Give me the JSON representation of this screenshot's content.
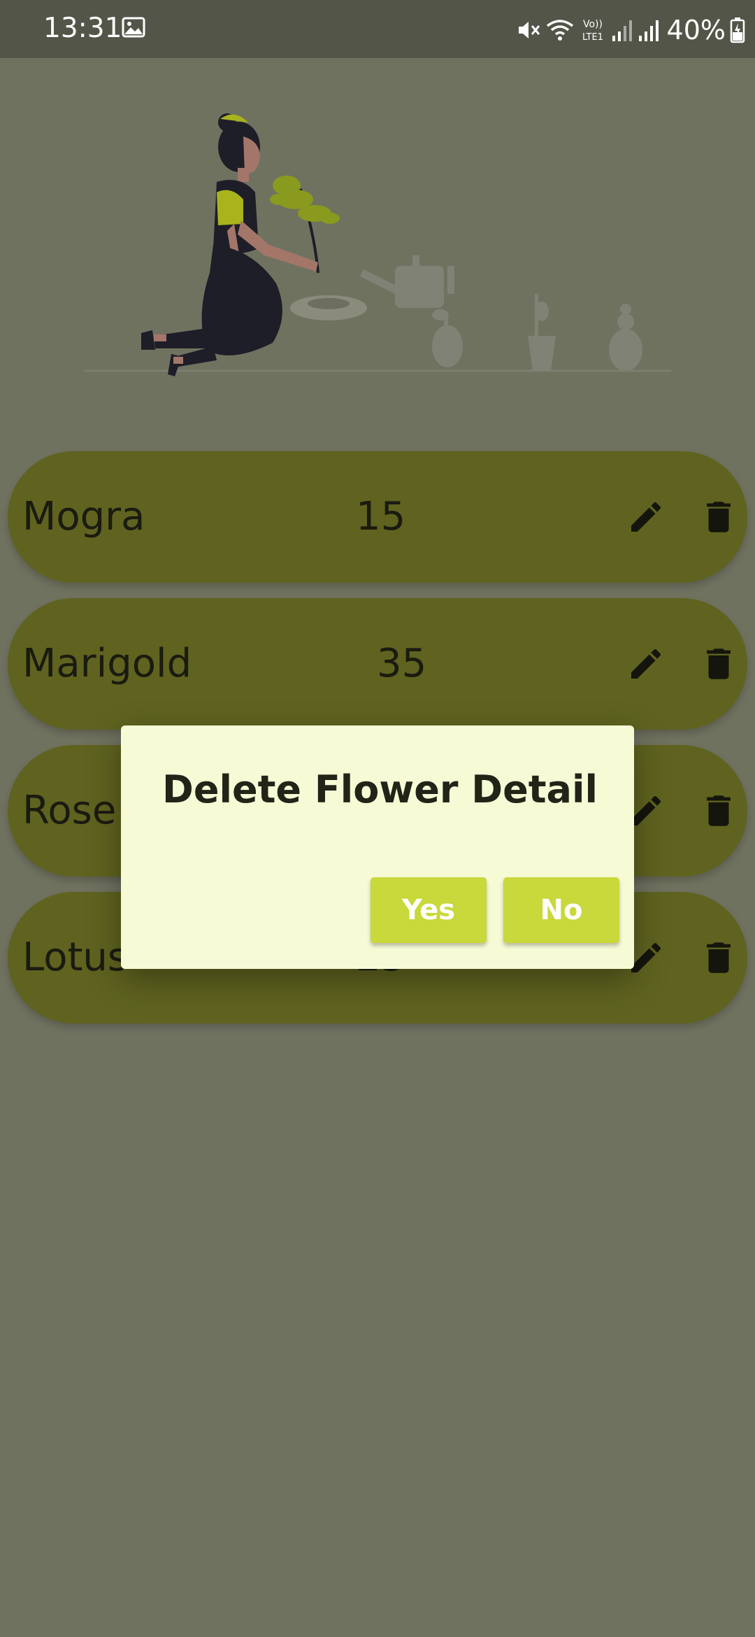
{
  "status_bar": {
    "time": "13:31",
    "battery": "40%",
    "icons": [
      "gallery-icon",
      "mute-icon",
      "wifi-icon",
      "volte-icon",
      "signal-icon",
      "signal-icon",
      "battery-charging-icon"
    ],
    "volte_label_top": "Vo))",
    "volte_label_bottom": "LTE1"
  },
  "illustration": {
    "icon": "gardening-woman-illustration"
  },
  "flowers": [
    {
      "name": "Mogra",
      "quantity": "15",
      "edit_icon": "pencil-icon",
      "delete_icon": "trash-icon"
    },
    {
      "name": "Marigold",
      "quantity": "35",
      "edit_icon": "pencil-icon",
      "delete_icon": "trash-icon"
    },
    {
      "name": "Rose",
      "quantity": "",
      "edit_icon": "pencil-icon",
      "delete_icon": "trash-icon"
    },
    {
      "name": "Lotus",
      "quantity": "25",
      "edit_icon": "pencil-icon",
      "delete_icon": "trash-icon"
    }
  ],
  "dialog": {
    "title": "Delete Flower Detail",
    "yes_label": "Yes",
    "no_label": "No"
  },
  "colors": {
    "scrim_background": "#707260",
    "status_bar": "#535548",
    "row_background": "#5f631f",
    "dialog_background": "#f6fbd6",
    "dialog_button": "#c9d83a",
    "accent_plant": "#8a9a1e"
  }
}
